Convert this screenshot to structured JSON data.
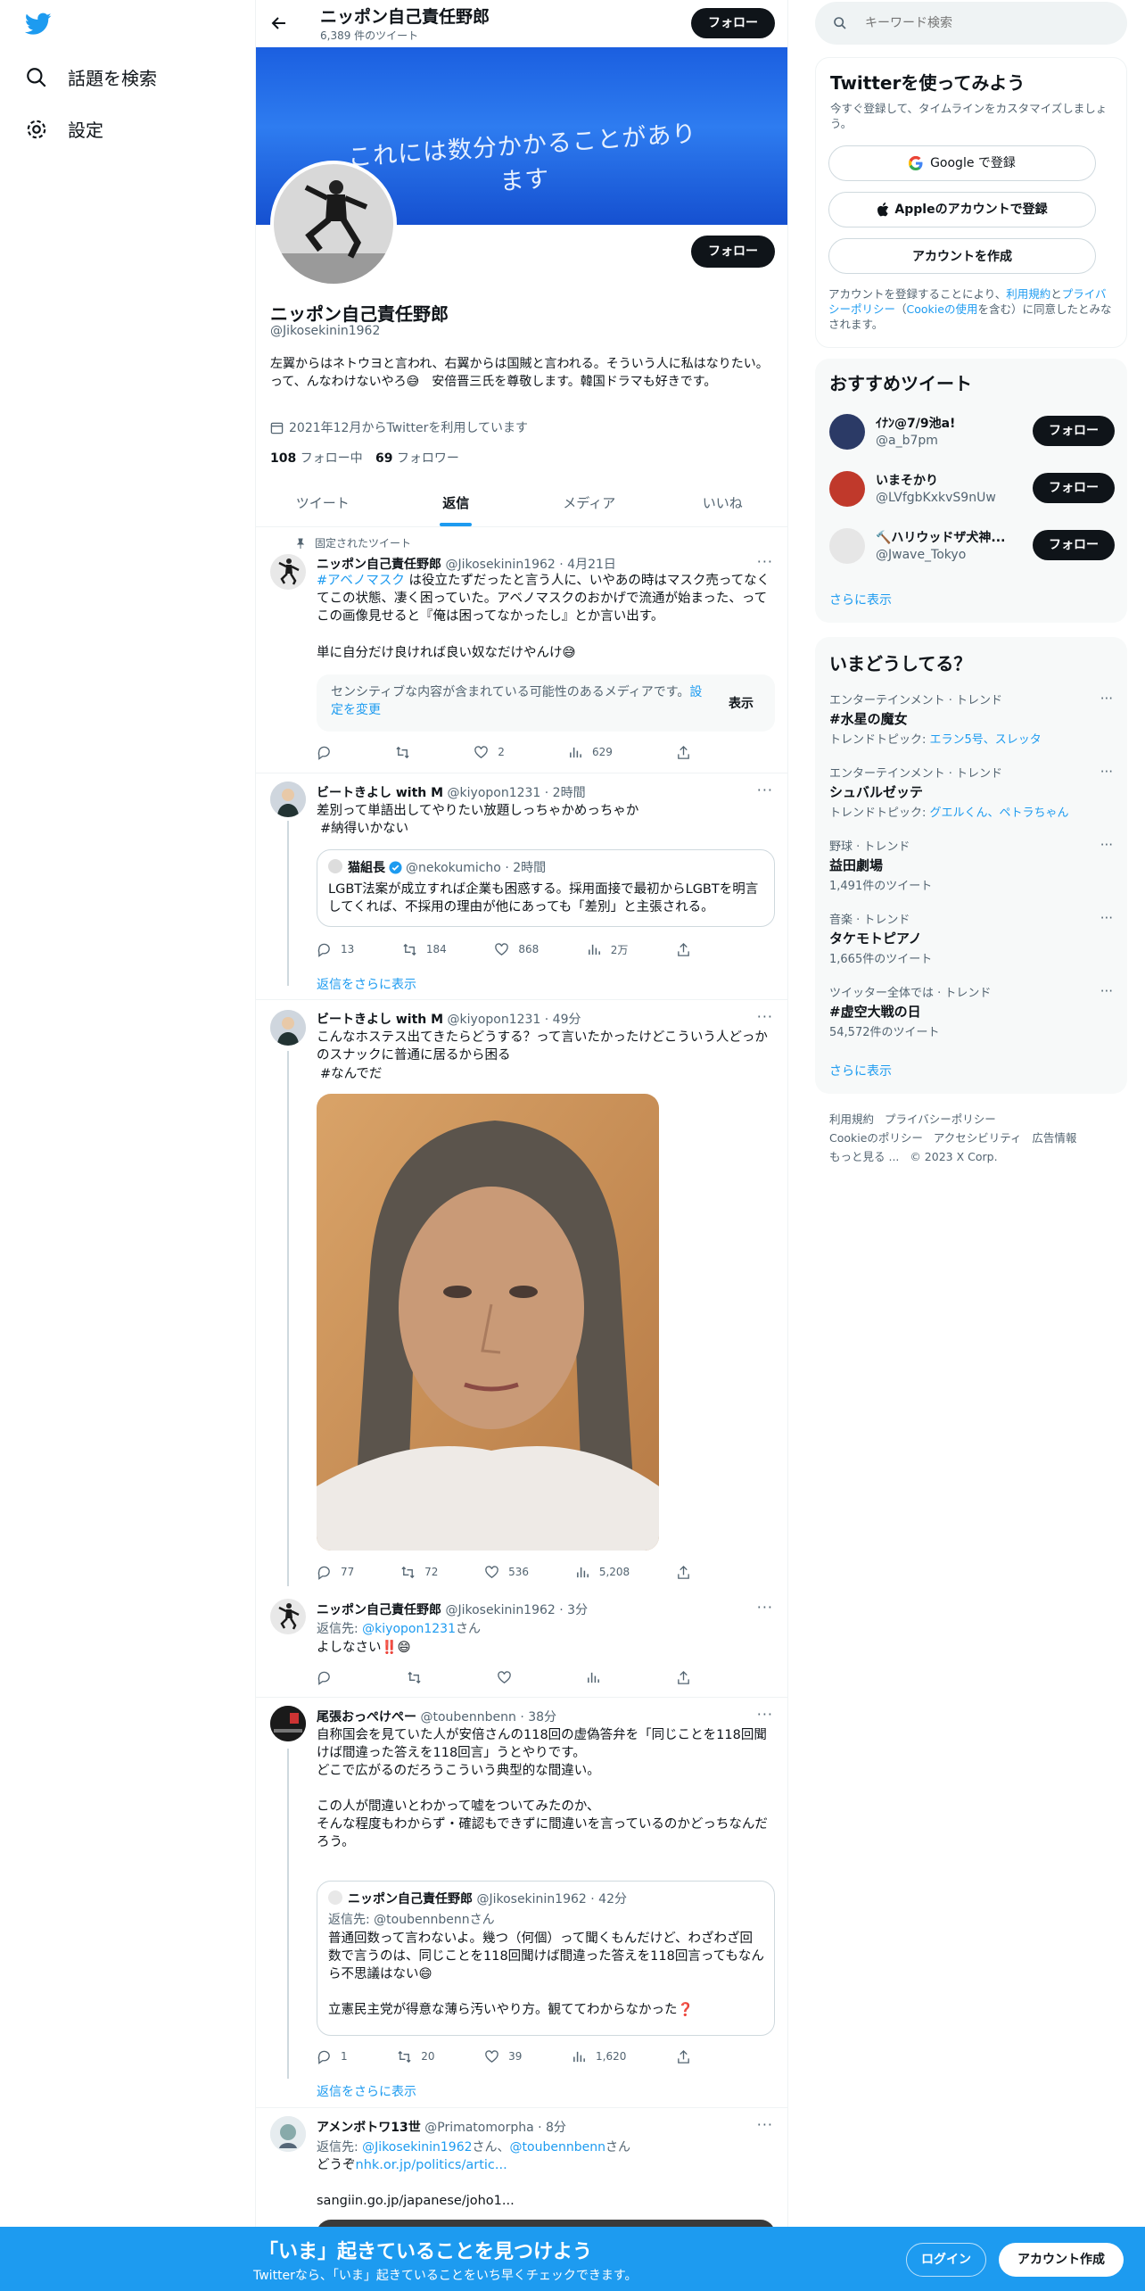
{
  "nav": {
    "search_label": "話題を検索",
    "settings_label": "設定"
  },
  "header": {
    "title": "ニッポン自己責任野郎",
    "tweet_count": "6,389 件のツイート",
    "follow_label": "フォロー"
  },
  "banner": {
    "text": "これには数分かかることがあります"
  },
  "profile": {
    "name": "ニッポン自己責任野郎",
    "handle": "@Jikosekinin1962",
    "bio": "左翼からはネトウヨと言われ、右翼からは国賊と言われる。そういう人に私はなりたい。って、んなわけないやろ😅　安倍晋三氏を尊敬します。韓国ドラマも好きです。",
    "joined": "2021年12月からTwitterを利用しています",
    "following_count": "108",
    "following_label": "フォロー中",
    "followers_count": "69",
    "followers_label": "フォロワー",
    "follow_label": "フォロー"
  },
  "tabs": [
    "ツイート",
    "返信",
    "メディア",
    "いいね"
  ],
  "tweets": {
    "t1": {
      "pinned_label": "固定されたツイート",
      "name": "ニッポン自己責任野郎",
      "meta": "@Jikosekinin1962 · 4月21日",
      "hashtag": "#アベノマスク",
      "text_a": " は役立たずだったと言う人に、いやあの時はマスク売ってなくてこの状態、凄く困っていた。アベノマスクのおかげで流通が始まった、ってこの画像見せると『俺は困ってなかったし』とか言い出す。",
      "text_b": "単に自分だけ良ければ良い奴なだけやんけ😅",
      "sensitive": "センシティブな内容が含まれている可能性のあるメディアです。",
      "sensitive_link": "設定を変更",
      "show_label": "表示",
      "likes": "2",
      "views": "629"
    },
    "t2": {
      "name": "ビートきよし with M",
      "meta": "@kiyopon1231 · 2時間",
      "text": "差別って単語出してやりたい放題しっちゃかめっちゃか",
      "hashtag": "#納得いかない",
      "quote_name": "猫組長",
      "quote_meta": "@nekokumicho · 2時間",
      "quote_text": "LGBT法案が成立すれば企業も困惑する。採用面接で最初からLGBTを明言してくれば、不採用の理由が他にあっても「差別」と主張される。",
      "replies": "13",
      "retweets": "184",
      "likes": "868",
      "views": "2万",
      "show_more": "返信をさらに表示"
    },
    "t3": {
      "name": "ビートきよし with M",
      "meta": "@kiyopon1231 · 49分",
      "text": "こんなホステス出てきたらどうする？って言いたかったけどこういう人どっかのスナックに普通に居るから困る",
      "hashtag": "#なんでだ",
      "replies": "77",
      "retweets": "72",
      "likes": "536",
      "views": "5,208"
    },
    "t4": {
      "name": "ニッポン自己責任野郎",
      "meta": "@Jikosekinin1962 · 3分",
      "reply_prefix": "返信先: ",
      "reply_to": "@kiyopon1231",
      "reply_suffix": "さん",
      "text": "よしなさい‼️😄"
    },
    "t5": {
      "name": "尾張おっぺけぺー",
      "meta": "@toubennbenn · 38分",
      "text": "自称国会を見ていた人が安倍さんの118回の虚偽答弁を「同じことを118回聞けば間違った答えを118回言」うとやりです。\nどこで広がるのだろうこういう典型的な間違い。\n\nこの人が間違いとわかって嘘をついてみたのか、\nそんな程度もわからず・確認もできずに間違いを言っているのかどっちなんだろう。",
      "quote_name": "ニッポン自己責任野郎",
      "quote_meta": "@Jikosekinin1962 · 42分",
      "quote_reply": "返信先: @toubennbennさん",
      "quote_text": "普通回数って言わないよ。幾つ（何個）って聞くもんだけど、わざわざ回数で言うのは、同じことを118回聞けば間違った答えを118回言ってもなんら不思議はない😄\n\n立憲民主党が得意な薄ら汚いやり方。観ててわからなかった❓",
      "replies": "1",
      "retweets": "20",
      "likes": "39",
      "views": "1,620",
      "show_more": "返信をさらに表示"
    },
    "t6": {
      "name": "アメンボトワ13世",
      "meta": "@Primatomorpha · 8分",
      "reply_prefix": "返信先: ",
      "reply_to_1": "@Jikosekinin1962",
      "reply_mid": "さん、",
      "reply_to_2": "@toubennbenn",
      "reply_suffix": "さん",
      "text": "どうぞ",
      "link1": "nhk.or.jp/politics/artic...",
      "link2": "sangiin.go.jp/japanese/joho1..."
    }
  },
  "search": {
    "placeholder": "キーワード検索"
  },
  "signup": {
    "title": "Twitterを使ってみよう",
    "subtitle": "今すぐ登録して、タイムラインをカスタマイズしましょう。",
    "google": "Google で登録",
    "apple": "Appleのアカウントで登録",
    "create": "アカウントを作成",
    "legal_a": "アカウントを登録することにより、",
    "legal_terms": "利用規約",
    "legal_and": "と",
    "legal_privacy": "プライバシーポリシー",
    "legal_open": "（",
    "legal_cookie": "Cookieの使用",
    "legal_b": "を含む）に同意したとみなされます。"
  },
  "recommend": {
    "title": "おすすめツイート",
    "users": [
      {
        "name": "ｲﾅﾝ@7/9池a!",
        "handle": "@a_b7pm"
      },
      {
        "name": "いまそかり",
        "handle": "@LVfgbKxkvS9nUw"
      },
      {
        "name": "🔨ハリウッドザ犬神...",
        "handle": "@Jwave_Tokyo"
      }
    ],
    "follow_label": "フォロー",
    "more": "さらに表示"
  },
  "trends": {
    "title": "いまどうしてる？",
    "items": [
      {
        "cat": "エンターテインメント · トレンド",
        "name": "#水星の魔女",
        "sub_prefix": "トレンドトピック: ",
        "sub_link": "エラン5号、スレッタ"
      },
      {
        "cat": "エンターテインメント · トレンド",
        "name": "シュバルゼッテ",
        "sub_prefix": "トレンドトピック: ",
        "sub_link": "グエルくん、ペトラちゃん"
      },
      {
        "cat": "野球 · トレンド",
        "name": "益田劇場",
        "sub_prefix": "1,491件のツイート",
        "sub_link": ""
      },
      {
        "cat": "音楽 · トレンド",
        "name": "タケモトピアノ",
        "sub_prefix": "1,665件のツイート",
        "sub_link": ""
      },
      {
        "cat": "ツイッター全体では · トレンド",
        "name": "#虚空大戦の日",
        "sub_prefix": "54,572件のツイート",
        "sub_link": ""
      }
    ],
    "more": "さらに表示"
  },
  "footer": {
    "terms": "利用規約",
    "privacy": "プライバシーポリシー",
    "cookie": "Cookieのポリシー",
    "access": "アクセシビリティ",
    "ads": "広告情報",
    "more": "もっと見る ...",
    "copyright": "© 2023 X Corp."
  },
  "bottom": {
    "title": "「いま」起きていることを見つけよう",
    "subtitle": "Twitterなら、「いま」起きていることをいち早くチェックできます。",
    "login": "ログイン",
    "signup": "アカウント作成"
  },
  "colors": {
    "accent": "#1d9bf0",
    "dark": "#0f1419",
    "muted": "#536471"
  }
}
